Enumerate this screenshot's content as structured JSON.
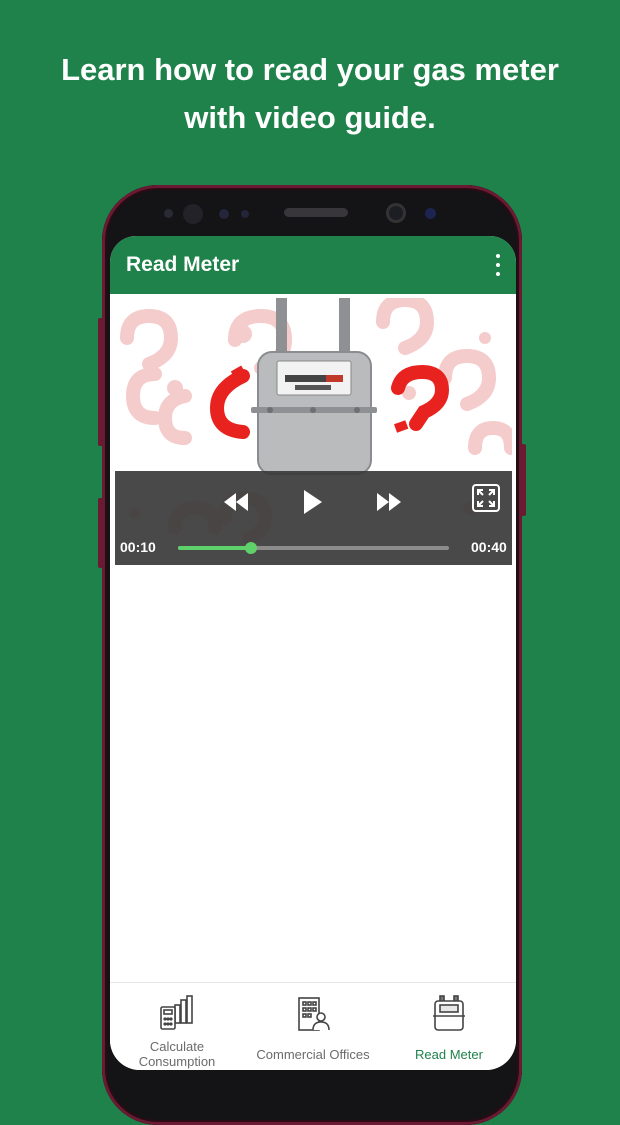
{
  "promo": {
    "line1": "Learn how to read your gas meter",
    "line2": "with video guide."
  },
  "app_bar": {
    "title": "Read Meter",
    "menu_icon": "more-vertical-icon"
  },
  "video_player": {
    "current_time": "00:10",
    "duration": "00:40",
    "progress_fraction": 0.27,
    "controls": [
      "rewind-icon",
      "play-icon",
      "fast-forward-icon",
      "fullscreen-icon"
    ]
  },
  "bottom_nav": {
    "items": [
      {
        "label_line1": "Calculate",
        "label_line2": "Consumption",
        "icon": "calculator-chart-icon",
        "active": false
      },
      {
        "label": "Commercial Offices",
        "icon": "office-building-icon",
        "active": false
      },
      {
        "label": "Read Meter",
        "icon": "gas-meter-icon",
        "active": true
      }
    ]
  },
  "colors": {
    "brand_green": "#1f824a",
    "progress_green": "#5fd16a",
    "question_red": "#e8231f"
  }
}
